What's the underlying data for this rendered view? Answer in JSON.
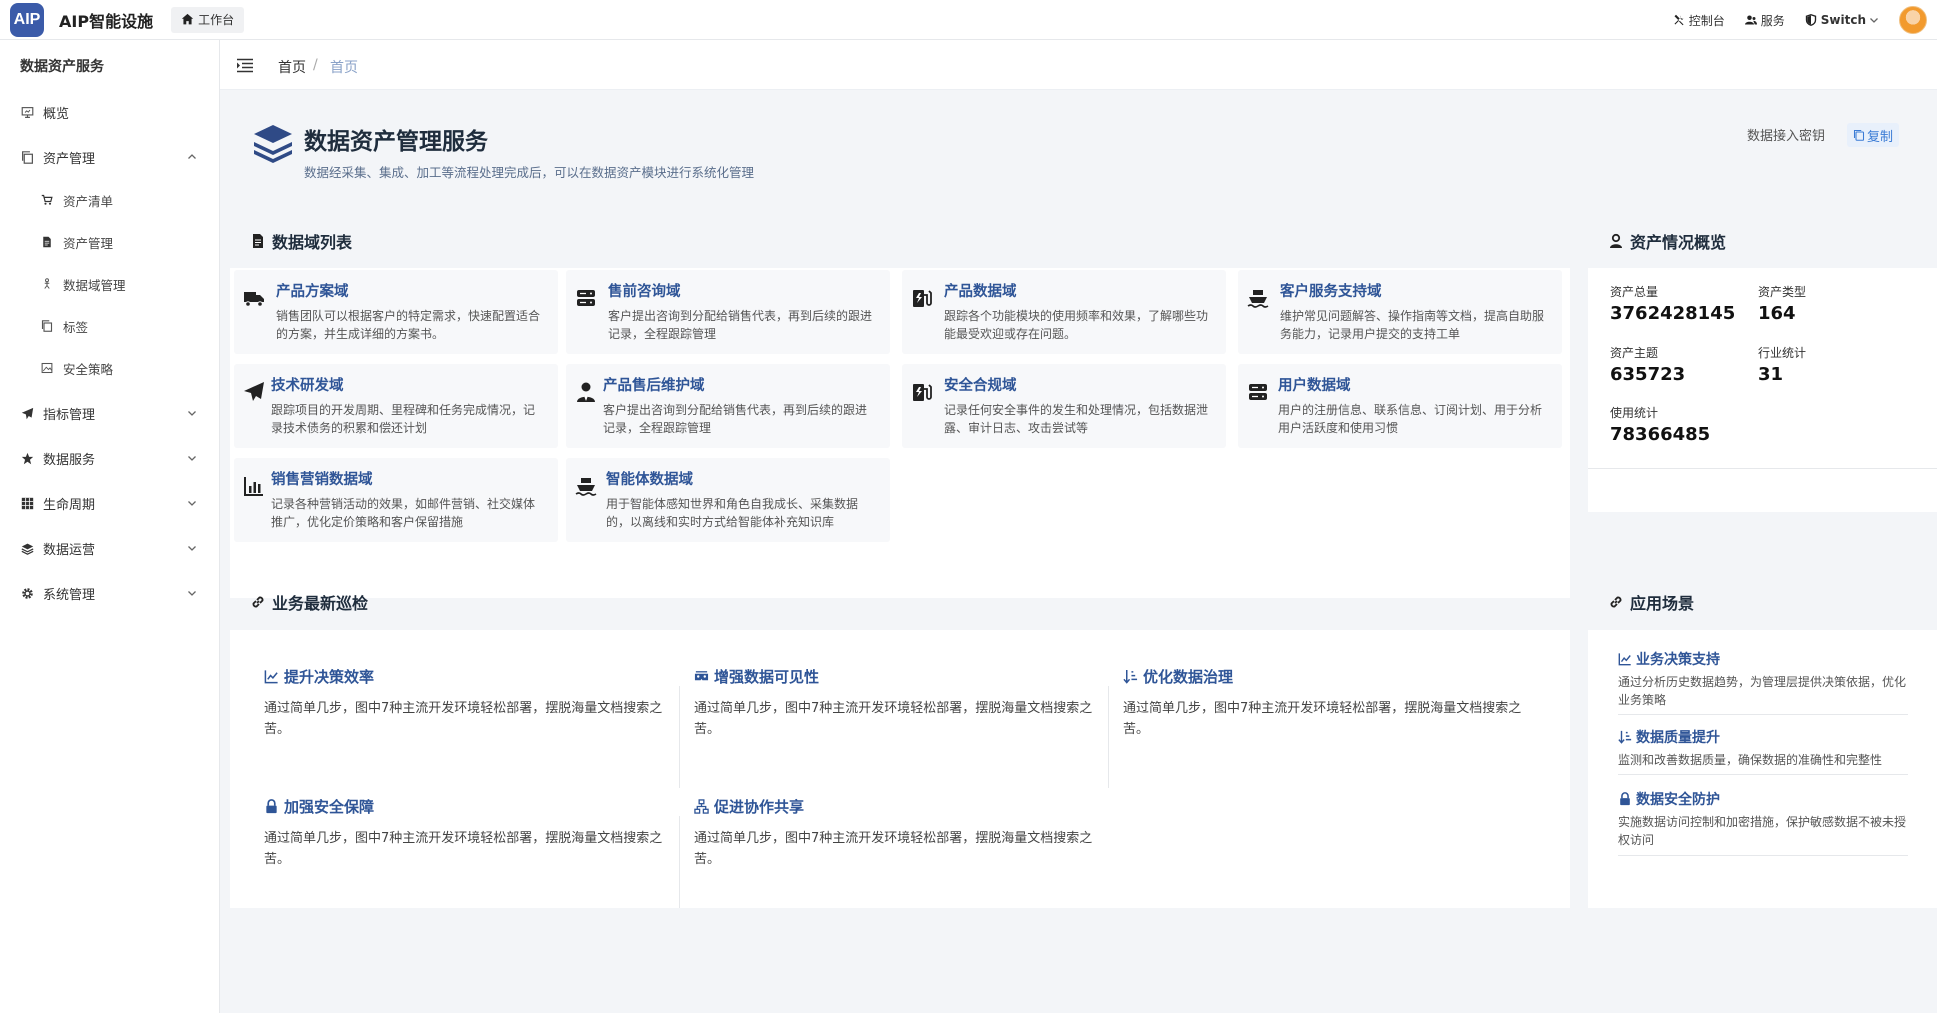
{
  "app": {
    "logo_text": "AIP",
    "title": "AIP智能设施",
    "workspace_label": "工作台"
  },
  "topnav": {
    "console": "控制台",
    "service": "服务",
    "switch": "Switch"
  },
  "sidebar": {
    "title": "数据资产服务",
    "items": [
      {
        "label": "概览",
        "icon": "monitor-icon"
      },
      {
        "label": "资产管理",
        "icon": "copy-icon",
        "expanded": true,
        "children": [
          {
            "label": "资产清单",
            "icon": "cart-icon"
          },
          {
            "label": "资产管理",
            "icon": "file-icon"
          },
          {
            "label": "数据域管理",
            "icon": "person-icon"
          },
          {
            "label": "标签",
            "icon": "copy-icon"
          },
          {
            "label": "安全策略",
            "icon": "image-icon"
          }
        ]
      },
      {
        "label": "指标管理",
        "icon": "send-icon"
      },
      {
        "label": "数据服务",
        "icon": "star-icon"
      },
      {
        "label": "生命周期",
        "icon": "grid-icon"
      },
      {
        "label": "数据运营",
        "icon": "layers-icon"
      },
      {
        "label": "系统管理",
        "icon": "gear-icon"
      }
    ]
  },
  "breadcrumb": {
    "home": "首页",
    "sep": "/",
    "current": "首页"
  },
  "hero": {
    "title": "数据资产管理服务",
    "subtitle": "数据经采集、集成、加工等流程处理完成后，可以在数据资产模块进行系统化管理",
    "key_label": "数据接入密钥",
    "copy_label": "复制"
  },
  "domains": {
    "title": "数据域列表",
    "items": [
      {
        "name": "产品方案域",
        "icon": "truck-icon",
        "desc": "销售团队可以根据客户的特定需求，快速配置适合的方案，并生成详细的方案书。"
      },
      {
        "name": "售前咨询域",
        "icon": "server-icon",
        "desc": "客户提出咨询到分配给销售代表，再到后续的跟进记录，全程跟踪管理"
      },
      {
        "name": "产品数据域",
        "icon": "charging-icon",
        "desc": "跟踪各个功能模块的使用频率和效果，了解哪些功能最受欢迎或存在问题。"
      },
      {
        "name": "客户服务支持域",
        "icon": "ship-icon",
        "desc": "维护常见问题解答、操作指南等文档，提高自助服务能力，记录用户提交的支持工单"
      },
      {
        "name": "技术研发域",
        "icon": "paper-plane-icon",
        "desc": "跟踪项目的开发周期、里程碑和任务完成情况，记录技术债务的积累和偿还计划"
      },
      {
        "name": "产品售后维护域",
        "icon": "user-tie-icon",
        "desc": "客户提出咨询到分配给销售代表，再到后续的跟进记录，全程跟踪管理"
      },
      {
        "name": "安全合规域",
        "icon": "charging-icon",
        "desc": "记录任何安全事件的发生和处理情况，包括数据泄露、审计日志、攻击尝试等"
      },
      {
        "name": "用户数据域",
        "icon": "server-icon",
        "desc": "用户的注册信息、联系信息、订阅计划、用于分析用户活跃度和使用习惯"
      },
      {
        "name": "销售营销数据域",
        "icon": "bar-chart-icon",
        "desc": "记录各种营销活动的效果，如邮件营销、社交媒体推广，优化定价策略和客户保留措施"
      },
      {
        "name": "智能体数据域",
        "icon": "ship-icon",
        "desc": "用于智能体感知世界和角色自我成长、采集数据的，以离线和实时方式给智能体补充知识库"
      }
    ]
  },
  "overview": {
    "title": "资产情况概览",
    "stats": [
      {
        "label": "资产总量",
        "value": "3762428145"
      },
      {
        "label": "资产类型",
        "value": "164"
      },
      {
        "label": "资产主题",
        "value": "635723"
      },
      {
        "label": "行业统计",
        "value": "31"
      },
      {
        "label": "使用统计",
        "value": "78366485"
      }
    ]
  },
  "inspection": {
    "title": "业务最新巡检",
    "items": [
      {
        "title": "提升决策效率",
        "icon": "line-chart-icon",
        "desc": "通过简单几步，图中7种主流开发环境轻松部署，摆脱海量文档搜索之苦。"
      },
      {
        "title": "增强数据可见性",
        "icon": "eye-group-icon",
        "desc": "通过简单几步，图中7种主流开发环境轻松部署，摆脱海量文档搜索之苦。"
      },
      {
        "title": "优化数据治理",
        "icon": "sort-icon",
        "desc": "通过简单几步，图中7种主流开发环境轻松部署，摆脱海量文档搜索之苦。"
      },
      {
        "title": "加强安全保障",
        "icon": "lock-icon",
        "desc": "通过简单几步，图中7种主流开发环境轻松部署，摆脱海量文档搜索之苦。"
      },
      {
        "title": "促进协作共享",
        "icon": "sitemap-icon",
        "desc": "通过简单几步，图中7种主流开发环境轻松部署，摆脱海量文档搜索之苦。"
      }
    ]
  },
  "scenes": {
    "title": "应用场景",
    "items": [
      {
        "title": "业务决策支持",
        "icon": "line-chart-icon",
        "desc": "通过分析历史数据趋势，为管理层提供决策依据，优化业务策略"
      },
      {
        "title": "数据质量提升",
        "icon": "sort-icon",
        "desc": "监测和改善数据质量，确保数据的准确性和完整性"
      },
      {
        "title": "数据安全防护",
        "icon": "lock-icon",
        "desc": "实施数据访问控制和加密措施，保护敏感数据不被未授权访问"
      }
    ]
  },
  "colors": {
    "brand": "#3b5ba9",
    "link": "#2f5597",
    "accent": "#3a7bd5",
    "bg": "#f3f5f8"
  }
}
